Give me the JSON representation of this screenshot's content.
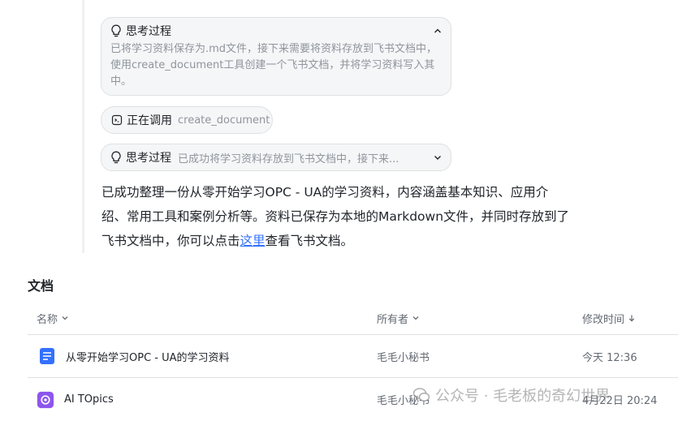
{
  "thinking_expanded": {
    "title": "思考过程",
    "body": "已将学习资料保存为.md文件，接下来需要将资料存放到飞书文档中，使用create_document工具创建一个飞书文档，并将学习资料写入其中。"
  },
  "tool_call": {
    "label": "正在调用",
    "tool_name": "create_document"
  },
  "thinking_collapsed": {
    "title": "思考过程",
    "preview": "已成功将学习资料存放到飞书文档中，接下来..."
  },
  "answer": {
    "text": "已成功整理一份从零开始学习OPC - UA的学习资料，内容涵盖基本知识、应用介绍、常用工具和案例分析等。资料已保存为本地的Markdown文件，并同时存放到了飞书文档中，你可以点击",
    "link": "这里",
    "suffix": "查看飞书文档。"
  },
  "documents": {
    "section_title": "文档",
    "columns": {
      "name": "名称",
      "owner": "所有者",
      "modified": "修改时间"
    },
    "rows": [
      {
        "name": "从零开始学习OPC - UA的学习资料",
        "owner": "毛毛小秘书",
        "modified": "今天 12:36",
        "icon": "doc-icon"
      },
      {
        "name": "AI TOpics",
        "owner": "毛毛小秘书",
        "modified": "4月22日 20:24",
        "icon": "app-icon"
      }
    ]
  },
  "watermark": {
    "text": "公众号 · 毛老板的奇幻世界"
  },
  "colors": {
    "link": "#3370ff",
    "doc_icon": "#3370ff",
    "app_icon": "#8d55ed",
    "card_bg": "#f5f6f7",
    "border": "#dee0e3"
  }
}
